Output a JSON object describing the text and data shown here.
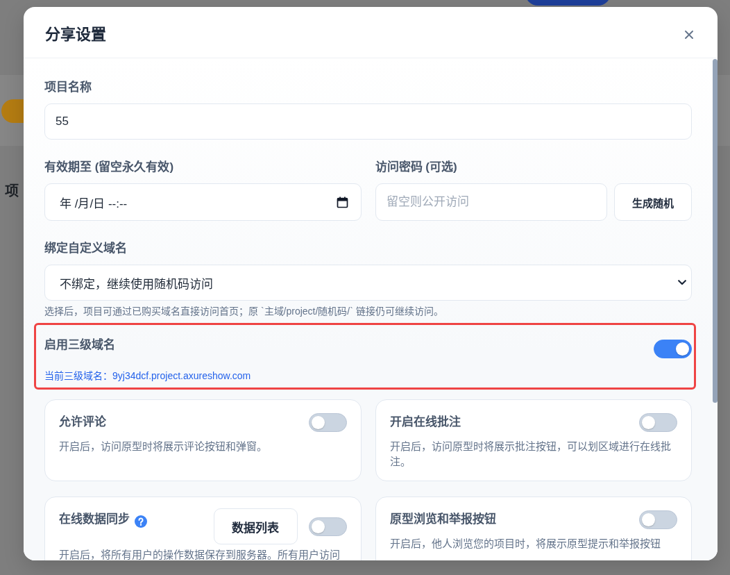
{
  "backdrop": {
    "heading": "项"
  },
  "dialog": {
    "title": "分享设置"
  },
  "form": {
    "project_name": {
      "label": "项目名称",
      "value": "55"
    },
    "expiry": {
      "label": "有效期至 (留空永久有效)",
      "value": "年 /月/日 --:--"
    },
    "password": {
      "label": "访问密码 (可选)",
      "placeholder": "留空则公开访问",
      "button": "生成随机"
    },
    "custom_domain": {
      "label": "绑定自定义域名",
      "value": "不绑定，继续使用随机码访问",
      "hint": "选择后，项目可通过已购买域名直接访问首页；原 `主域/project/随机码/` 链接仍可继续访问。"
    },
    "subdomain": {
      "label": "启用三级域名",
      "on": true,
      "highlighted": true,
      "current": "当前三级域名：9yj34dcf.project.axureshow.com"
    }
  },
  "options": [
    {
      "kind": "toggle",
      "title": "允许评论",
      "on": false,
      "description": "开启后，访问原型时将展示评论按钮和弹窗。"
    },
    {
      "kind": "toggle",
      "title": "开启在线批注",
      "on": false,
      "description": "开启后，访问原型时将展示批注按钮，可以划区域进行在线批注。"
    },
    {
      "kind": "toggle_help_button",
      "title": "在线数据同步",
      "button": "数据列表",
      "on": false,
      "description": "开启后，将所有用户的操作数据保存到服务器。所有用户访问"
    },
    {
      "kind": "toggle",
      "title": "原型浏览和举报按钮",
      "on": false,
      "description": "开启后，他人浏览您的项目时，将展示原型提示和举报按钮"
    }
  ]
}
